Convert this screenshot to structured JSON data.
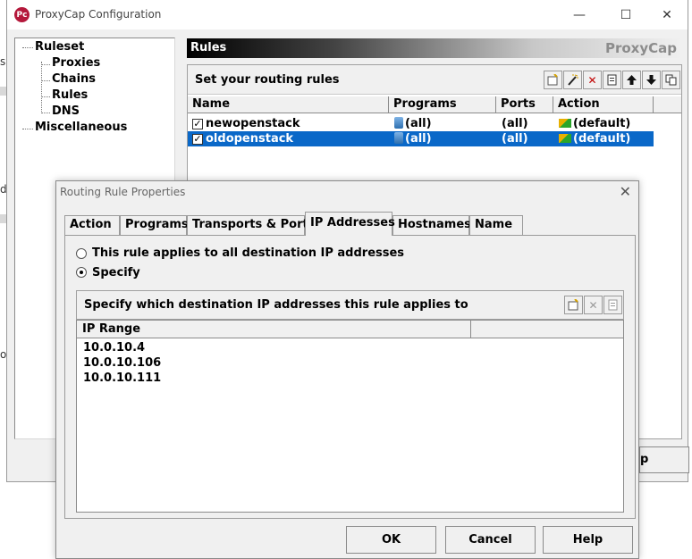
{
  "app": {
    "title": "ProxyCap Configuration",
    "icon_text": "Pc",
    "window_controls": {
      "minimize": "—",
      "maximize": "☐",
      "close": "✕"
    }
  },
  "background_fragments": [
    "s",
    "de",
    "o"
  ],
  "tree": {
    "items": [
      {
        "label": "Ruleset"
      },
      {
        "label": "Proxies"
      },
      {
        "label": "Chains"
      },
      {
        "label": "Rules"
      },
      {
        "label": "DNS"
      },
      {
        "label": "Miscellaneous"
      }
    ]
  },
  "rules": {
    "header": "Rules",
    "brand": "ProxyCap",
    "bar_text": "Set your routing rules",
    "columns": [
      "Name",
      "Programs",
      "Ports",
      "Action"
    ],
    "rows": [
      {
        "name": "newopenstack",
        "programs": "(all)",
        "ports": "(all)",
        "action": "(default)",
        "checked": true,
        "selected": false
      },
      {
        "name": "oldopenstack",
        "programs": "(all)",
        "ports": "(all)",
        "action": "(default)",
        "checked": true,
        "selected": true
      }
    ],
    "toolbar_icons": [
      "new-rule-icon",
      "wizard-icon",
      "delete-icon",
      "properties-icon",
      "move-up-icon",
      "move-down-icon",
      "copy-icon"
    ],
    "partial_button": "p"
  },
  "dialog": {
    "title": "Routing Rule Properties",
    "close": "✕",
    "tabs": [
      "Action",
      "Programs",
      "Transports & Ports",
      "IP Addresses",
      "Hostnames",
      "Name"
    ],
    "active_tab": "IP Addresses",
    "radio_all": "This rule applies to all destination IP addresses",
    "radio_specify": "Specify",
    "selected_radio": "Specify",
    "ip_bar_text": "Specify which destination IP addresses this rule applies to",
    "ip_columns": [
      "IP Range",
      ""
    ],
    "ip_ranges": [
      "10.0.10.4",
      "10.0.10.106",
      "10.0.10.111"
    ],
    "buttons": {
      "ok": "OK",
      "cancel": "Cancel",
      "help": "Help"
    }
  },
  "colors": {
    "selection": "#0a68c8",
    "window_bg": "#f0f0f0",
    "brand_gray": "#8c8c8c"
  }
}
